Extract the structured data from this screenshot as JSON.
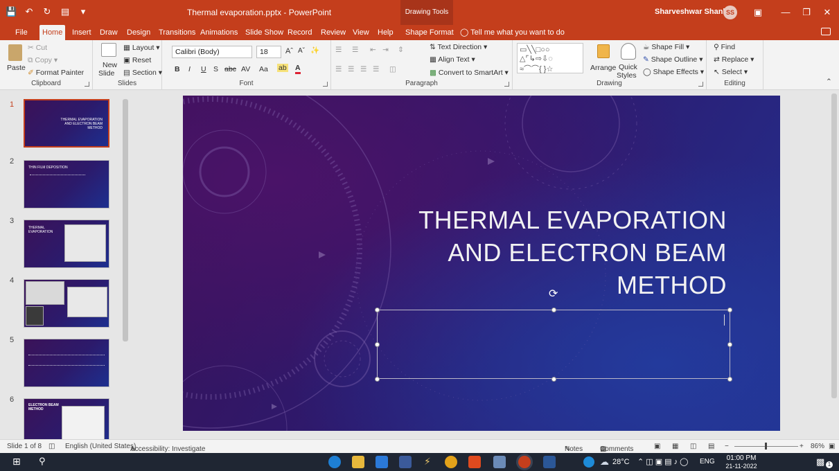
{
  "titlebar": {
    "document_title": "Thermal evaporation.pptx  -  PowerPoint",
    "context_title": "Drawing Tools",
    "user_name": "Sharveshwar Shankar",
    "user_initials": "SS"
  },
  "tabs": [
    {
      "label": "File"
    },
    {
      "label": "Home"
    },
    {
      "label": "Insert"
    },
    {
      "label": "Draw"
    },
    {
      "label": "Design"
    },
    {
      "label": "Transitions"
    },
    {
      "label": "Animations"
    },
    {
      "label": "Slide Show"
    },
    {
      "label": "Record"
    },
    {
      "label": "Review"
    },
    {
      "label": "View"
    },
    {
      "label": "Help"
    },
    {
      "label": "Shape Format"
    }
  ],
  "tell_me": "Tell me what you want to do",
  "ribbon": {
    "clipboard": {
      "paste": "Paste",
      "cut": "Cut",
      "copy": "Copy",
      "format_painter": "Format Painter",
      "label": "Clipboard"
    },
    "slides": {
      "new_slide_1": "New",
      "new_slide_2": "Slide",
      "layout": "Layout",
      "reset": "Reset",
      "section": "Section",
      "label": "Slides"
    },
    "font": {
      "family": "Calibri (Body)",
      "size": "18",
      "label": "Font"
    },
    "paragraph": {
      "text_direction": "Text Direction",
      "align_text": "Align Text",
      "smartart": "Convert to SmartArt",
      "label": "Paragraph"
    },
    "drawing": {
      "arrange": "Arrange",
      "quick_1": "Quick",
      "quick_2": "Styles",
      "shape_fill": "Shape Fill",
      "shape_outline": "Shape Outline",
      "shape_effects": "Shape Effects",
      "label": "Drawing"
    },
    "editing": {
      "find": "Find",
      "replace": "Replace",
      "select": "Select",
      "label": "Editing"
    }
  },
  "thumbnails": [
    {
      "num": "1",
      "title": "THERMAL EVAPORATION AND ELECTRON BEAM METHOD"
    },
    {
      "num": "2",
      "title": "THIN FILM DEPOSITION"
    },
    {
      "num": "3",
      "title": "THERMAL EVAPORATION"
    },
    {
      "num": "4",
      "title": ""
    },
    {
      "num": "5",
      "title": ""
    },
    {
      "num": "6",
      "title": "ELECTRON BEAM METHOD"
    }
  ],
  "slide": {
    "title_line1": "THERMAL EVAPORATION",
    "title_line2": "AND ELECTRON BEAM",
    "title_line3": "METHOD"
  },
  "status": {
    "slide_count": "Slide 1 of 8",
    "language": "English (United States)",
    "accessibility": "Accessibility: Investigate",
    "notes": "Notes",
    "comments": "Comments",
    "zoom": "86%"
  },
  "taskbar": {
    "temperature": "28°C",
    "lang": "ENG",
    "time": "01:00 PM",
    "date": "21-11-2022",
    "notif_count": "1"
  },
  "colors": {
    "accent": "#c43e1c",
    "taskbar": "#1f2633"
  }
}
